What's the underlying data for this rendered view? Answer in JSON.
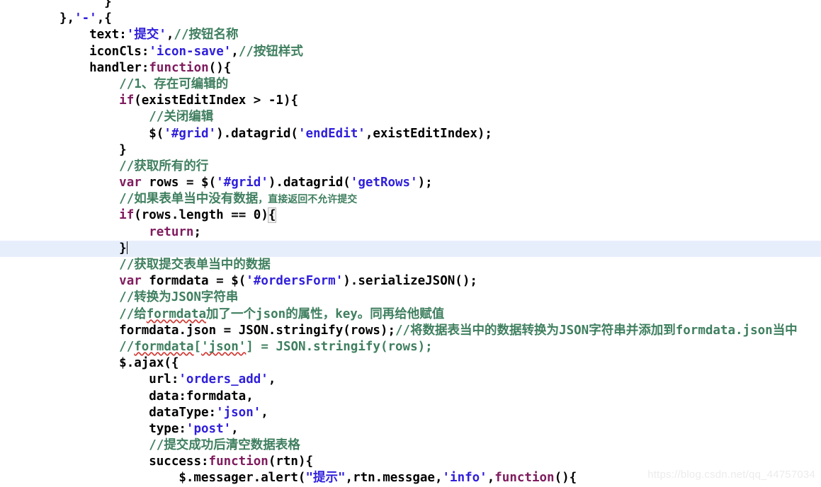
{
  "editor": {
    "background": "#ffffff",
    "current_line_background": "#e7eefb",
    "colors": {
      "keyword": "#7f1b5e",
      "string": "#2f1fdb",
      "comment": "#3f7f5f",
      "plain_text": "#000000",
      "squiggle": "#d03a34",
      "watermark": "#ececec"
    }
  },
  "watermark": {
    "text": "https://blog.csdn.net/qq_44757034"
  },
  "code": {
    "language": "javascript",
    "lines": [
      {
        "n": 1,
        "indent": 6,
        "current": false,
        "tokens": [
          {
            "t": "}",
            "c": "plain"
          }
        ]
      },
      {
        "n": 2,
        "indent": 0,
        "current": false,
        "tokens": [
          {
            "t": "},",
            "c": "plain"
          },
          {
            "t": "'-'",
            "c": "str"
          },
          {
            "t": ",{",
            "c": "plain"
          }
        ]
      },
      {
        "n": 3,
        "indent": 4,
        "current": false,
        "tokens": [
          {
            "t": "text:",
            "c": "plain"
          },
          {
            "t": "'",
            "c": "str"
          },
          {
            "t": "提交",
            "c": "cjk-str"
          },
          {
            "t": "'",
            "c": "str"
          },
          {
            "t": ",",
            "c": "plain"
          },
          {
            "t": "//",
            "c": "cmt"
          },
          {
            "t": "按钮名称",
            "c": "cmt-cjk"
          }
        ]
      },
      {
        "n": 4,
        "indent": 4,
        "current": false,
        "tokens": [
          {
            "t": "iconCls:",
            "c": "plain"
          },
          {
            "t": "'icon-save'",
            "c": "str"
          },
          {
            "t": ",",
            "c": "plain"
          },
          {
            "t": "//",
            "c": "cmt"
          },
          {
            "t": "按钮样式",
            "c": "cmt-cjk"
          }
        ]
      },
      {
        "n": 5,
        "indent": 4,
        "current": false,
        "tokens": [
          {
            "t": "handler:",
            "c": "plain"
          },
          {
            "t": "function",
            "c": "kw"
          },
          {
            "t": "(){",
            "c": "plain"
          }
        ]
      },
      {
        "n": 6,
        "indent": 8,
        "current": false,
        "tokens": [
          {
            "t": "//1",
            "c": "cmt"
          },
          {
            "t": "、存在可编辑的",
            "c": "cmt-cjk"
          }
        ]
      },
      {
        "n": 7,
        "indent": 8,
        "current": false,
        "tokens": [
          {
            "t": "if",
            "c": "kw"
          },
          {
            "t": "(existEditIndex > -1){",
            "c": "plain"
          }
        ]
      },
      {
        "n": 8,
        "indent": 12,
        "current": false,
        "tokens": [
          {
            "t": "//",
            "c": "cmt"
          },
          {
            "t": "关闭编辑",
            "c": "cmt-cjk"
          }
        ]
      },
      {
        "n": 9,
        "indent": 12,
        "current": false,
        "tokens": [
          {
            "t": "$(",
            "c": "plain"
          },
          {
            "t": "'#grid'",
            "c": "str"
          },
          {
            "t": ").datagrid(",
            "c": "plain"
          },
          {
            "t": "'endEdit'",
            "c": "str"
          },
          {
            "t": ",existEditIndex);",
            "c": "plain"
          }
        ]
      },
      {
        "n": 10,
        "indent": 8,
        "current": false,
        "tokens": [
          {
            "t": "}",
            "c": "plain"
          }
        ]
      },
      {
        "n": 11,
        "indent": 8,
        "current": false,
        "tokens": [
          {
            "t": "//",
            "c": "cmt"
          },
          {
            "t": "获取所有的行",
            "c": "cmt-cjk"
          }
        ]
      },
      {
        "n": 12,
        "indent": 8,
        "current": false,
        "tokens": [
          {
            "t": "var",
            "c": "kw"
          },
          {
            "t": " rows = $(",
            "c": "plain"
          },
          {
            "t": "'#grid'",
            "c": "str"
          },
          {
            "t": ").datagrid(",
            "c": "plain"
          },
          {
            "t": "'getRows'",
            "c": "str"
          },
          {
            "t": ");",
            "c": "plain"
          }
        ]
      },
      {
        "n": 13,
        "indent": 8,
        "current": false,
        "tokens": [
          {
            "t": "//",
            "c": "cmt"
          },
          {
            "t": "如果表单当中没有数据",
            "c": "cmt-cjk"
          },
          {
            "t": "，直接返回不允许提交",
            "c": "cmt-cjk-small"
          }
        ]
      },
      {
        "n": 14,
        "indent": 8,
        "current": false,
        "tokens": [
          {
            "t": "if",
            "c": "kw"
          },
          {
            "t": "(rows.length == 0)",
            "c": "plain"
          },
          {
            "t": "{",
            "c": "brace"
          }
        ]
      },
      {
        "n": 15,
        "indent": 12,
        "current": false,
        "tokens": [
          {
            "t": "return",
            "c": "kw"
          },
          {
            "t": ";",
            "c": "plain"
          }
        ]
      },
      {
        "n": 16,
        "indent": 8,
        "current": true,
        "tokens": [
          {
            "t": "}",
            "c": "plain"
          },
          {
            "t": "",
            "c": "caret"
          }
        ]
      },
      {
        "n": 17,
        "indent": 8,
        "current": false,
        "tokens": [
          {
            "t": "//",
            "c": "cmt"
          },
          {
            "t": "获取提交表单当中的数据",
            "c": "cmt-cjk"
          }
        ]
      },
      {
        "n": 18,
        "indent": 8,
        "current": false,
        "tokens": [
          {
            "t": "var",
            "c": "kw"
          },
          {
            "t": " formdata = $(",
            "c": "plain"
          },
          {
            "t": "'#ordersForm'",
            "c": "str"
          },
          {
            "t": ").serializeJSON();",
            "c": "plain"
          }
        ]
      },
      {
        "n": 19,
        "indent": 8,
        "current": false,
        "tokens": [
          {
            "t": "//",
            "c": "cmt"
          },
          {
            "t": "转换为",
            "c": "cmt-cjk"
          },
          {
            "t": "JSON",
            "c": "cmt"
          },
          {
            "t": "字符串",
            "c": "cmt-cjk"
          }
        ]
      },
      {
        "n": 20,
        "indent": 8,
        "current": false,
        "tokens": [
          {
            "t": "//",
            "c": "cmt"
          },
          {
            "t": "给",
            "c": "cmt-cjk"
          },
          {
            "t": "formdata",
            "c": "cmt-squig"
          },
          {
            "t": "加了一个",
            "c": "cmt-cjk"
          },
          {
            "t": "json",
            "c": "cmt"
          },
          {
            "t": "的属性，",
            "c": "cmt-cjk"
          },
          {
            "t": "key",
            "c": "cmt"
          },
          {
            "t": "。同再给他赋值",
            "c": "cmt-cjk"
          }
        ]
      },
      {
        "n": 21,
        "indent": 8,
        "current": false,
        "tokens": [
          {
            "t": "formdata.json = JSON.stringify(rows);",
            "c": "plain"
          },
          {
            "t": "//",
            "c": "cmt"
          },
          {
            "t": "将数据表当中的数据转换为",
            "c": "cmt-cjk"
          },
          {
            "t": "JSON",
            "c": "cmt"
          },
          {
            "t": "字符串并添加到",
            "c": "cmt-cjk"
          },
          {
            "t": "formdata.json",
            "c": "cmt"
          },
          {
            "t": "当中",
            "c": "cmt-cjk"
          }
        ]
      },
      {
        "n": 22,
        "indent": 8,
        "current": false,
        "tokens": [
          {
            "t": "//",
            "c": "cmt"
          },
          {
            "t": "formdata",
            "c": "cmt-squig"
          },
          {
            "t": "[",
            "c": "cmt"
          },
          {
            "t": "'json'",
            "c": "cmt-squig"
          },
          {
            "t": "] = JSON.stringify(rows);",
            "c": "cmt"
          }
        ]
      },
      {
        "n": 23,
        "indent": 8,
        "current": false,
        "tokens": [
          {
            "t": "$.ajax({",
            "c": "plain"
          }
        ]
      },
      {
        "n": 24,
        "indent": 12,
        "current": false,
        "tokens": [
          {
            "t": "url:",
            "c": "plain"
          },
          {
            "t": "'orders_add'",
            "c": "str"
          },
          {
            "t": ",",
            "c": "plain"
          }
        ]
      },
      {
        "n": 25,
        "indent": 12,
        "current": false,
        "tokens": [
          {
            "t": "data:formdata,",
            "c": "plain"
          }
        ]
      },
      {
        "n": 26,
        "indent": 12,
        "current": false,
        "tokens": [
          {
            "t": "dataType:",
            "c": "plain"
          },
          {
            "t": "'json'",
            "c": "str"
          },
          {
            "t": ",",
            "c": "plain"
          }
        ]
      },
      {
        "n": 27,
        "indent": 12,
        "current": false,
        "tokens": [
          {
            "t": "type:",
            "c": "plain"
          },
          {
            "t": "'post'",
            "c": "str"
          },
          {
            "t": ",",
            "c": "plain"
          }
        ]
      },
      {
        "n": 28,
        "indent": 12,
        "current": false,
        "tokens": [
          {
            "t": "//",
            "c": "cmt"
          },
          {
            "t": "提交成功后清空数据表格",
            "c": "cmt-cjk"
          }
        ]
      },
      {
        "n": 29,
        "indent": 12,
        "current": false,
        "tokens": [
          {
            "t": "success:",
            "c": "plain"
          },
          {
            "t": "function",
            "c": "kw"
          },
          {
            "t": "(rtn){",
            "c": "plain"
          }
        ]
      },
      {
        "n": 30,
        "indent": 16,
        "current": false,
        "tokens": [
          {
            "t": "$.messager.alert(",
            "c": "plain"
          },
          {
            "t": "\"",
            "c": "str"
          },
          {
            "t": "提示",
            "c": "cjk-str"
          },
          {
            "t": "\"",
            "c": "str"
          },
          {
            "t": ",rtn.messgae,",
            "c": "plain"
          },
          {
            "t": "'info'",
            "c": "str"
          },
          {
            "t": ",",
            "c": "plain"
          },
          {
            "t": "function",
            "c": "kw"
          },
          {
            "t": "(){",
            "c": "plain"
          }
        ]
      }
    ]
  }
}
